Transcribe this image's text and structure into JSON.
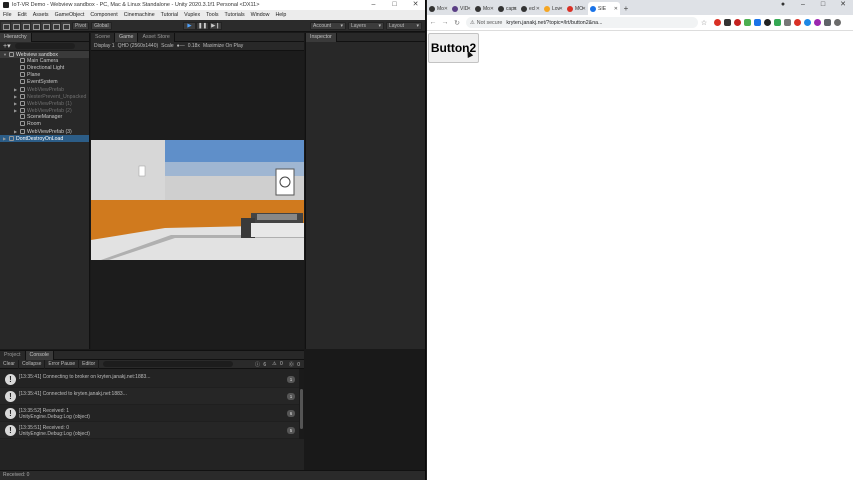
{
  "unity": {
    "title": "IoT-VR Demo - Webview sandbox - PC, Mac & Linux Standalone - Unity 2020.3.1f1 Personal <DX11>",
    "menu": [
      "File",
      "Edit",
      "Assets",
      "GameObject",
      "Component",
      "Cinemachine",
      "Tutorial",
      "Vuplex",
      "Tools",
      "Tutorials",
      "Window",
      "Help"
    ],
    "toolbar": {
      "pivot": "Pivot",
      "global": "Global",
      "account": "Account",
      "layers": "Layers",
      "layout": "Layout"
    },
    "hierarchy": {
      "title": "Hierarchy",
      "scene": "Webview sandbox",
      "items": [
        "Main Camera",
        "Directional Light",
        "Plane",
        "EventSystem",
        "WebViewPrefab",
        "NesterPrevent_Unpacked",
        "WebViewPrefab (1)",
        "WebViewPrefab (2)",
        "SceneManager",
        "Room",
        "WebViewPrefab (3)"
      ],
      "ddol": "DontDestroyOnLoad"
    },
    "scene_tabs": {
      "scene": "Scene",
      "game": "Game",
      "store": "Asset Store"
    },
    "game_bar": {
      "display": "Display 1",
      "resolution": "QHD (2560x1440)",
      "scale_label": "Scale",
      "scale_value": "0.18x",
      "maximize": "Maximize On Play"
    },
    "inspector": {
      "title": "Inspector"
    },
    "console": {
      "tab_project": "Project",
      "tab_console": "Console",
      "clear": "Clear",
      "collapse": "Collapse",
      "error_pause": "Error Pause",
      "editor": "Editor",
      "counts": {
        "log": "6",
        "warn": "0",
        "err": "0"
      },
      "entries": [
        {
          "line1": "[13:35:41] Connecting to broker on kryten.janakj.net:1883...",
          "line2": "",
          "count": "1"
        },
        {
          "line1": "[13:35:41] Connected to kryten.janakj.net:1883...",
          "line2": "",
          "count": "1"
        },
        {
          "line1": "[13:35:52] Received: 1",
          "line2": "UnityEngine.Debug:Log (object)",
          "count": "6"
        },
        {
          "line1": "[13:35:51] Received: 0",
          "line2": "UnityEngine.Debug:Log (object)",
          "count": "5"
        }
      ]
    },
    "status": "Received: 0"
  },
  "chrome": {
    "tabs": [
      {
        "label": "Mo",
        "fav": "#24292e"
      },
      {
        "label": "VID",
        "fav": "#5a3e85"
      },
      {
        "label": "Mo",
        "fav": "#24292e"
      },
      {
        "label": "caps",
        "fav": "#333333"
      },
      {
        "label": "ecl",
        "fav": "#24292e"
      },
      {
        "label": "Lov",
        "fav": "#f5a623"
      },
      {
        "label": "MO",
        "fav": "#d93025"
      },
      {
        "label": "SIE",
        "fav": "#1a73e8"
      }
    ],
    "not_secure": "Not secure",
    "url": "kryten.janakj.net/?topic=/lrt/button2&na...",
    "button_label": "Button2"
  }
}
